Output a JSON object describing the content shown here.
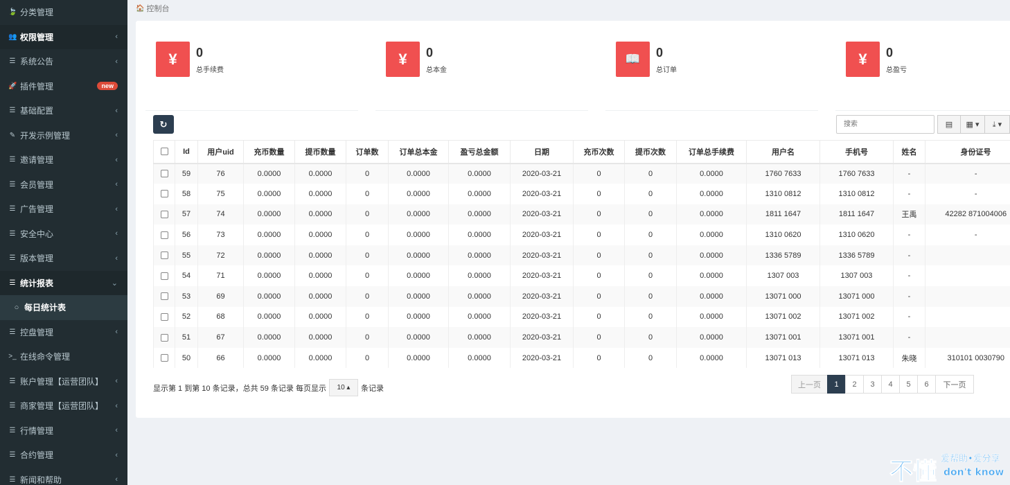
{
  "sidebar": {
    "items": [
      {
        "icon": "leaf-icon",
        "glyph": "🍃",
        "label": "分类管理",
        "chevron": "",
        "state": ""
      },
      {
        "icon": "users-icon",
        "glyph": "👥",
        "label": "权限管理",
        "chevron": "‹",
        "state": "active-bold"
      },
      {
        "icon": "list-icon",
        "glyph": "☰",
        "label": "系统公告",
        "chevron": "‹",
        "state": ""
      },
      {
        "icon": "rocket-icon",
        "glyph": "🚀",
        "label": "插件管理",
        "chevron": "",
        "state": "",
        "badge": "new"
      },
      {
        "icon": "list-icon",
        "glyph": "☰",
        "label": "基础配置",
        "chevron": "‹",
        "state": ""
      },
      {
        "icon": "magic-icon",
        "glyph": "✎",
        "label": "开发示例管理",
        "chevron": "‹",
        "state": ""
      },
      {
        "icon": "list-icon",
        "glyph": "☰",
        "label": "邀请管理",
        "chevron": "‹",
        "state": ""
      },
      {
        "icon": "list-icon",
        "glyph": "☰",
        "label": "会员管理",
        "chevron": "‹",
        "state": ""
      },
      {
        "icon": "list-icon",
        "glyph": "☰",
        "label": "广告管理",
        "chevron": "‹",
        "state": ""
      },
      {
        "icon": "list-icon",
        "glyph": "☰",
        "label": "安全中心",
        "chevron": "‹",
        "state": ""
      },
      {
        "icon": "list-icon",
        "glyph": "☰",
        "label": "版本管理",
        "chevron": "‹",
        "state": ""
      },
      {
        "icon": "list-icon",
        "glyph": "☰",
        "label": "统计报表",
        "chevron": "⌄",
        "state": "active-bold"
      },
      {
        "icon": "circle-icon",
        "glyph": "○",
        "label": "每日统计表",
        "chevron": "",
        "state": "sub"
      },
      {
        "icon": "list-icon",
        "glyph": "☰",
        "label": "控盘管理",
        "chevron": "‹",
        "state": ""
      },
      {
        "icon": "terminal-icon",
        "glyph": ">_",
        "label": "在线命令管理",
        "chevron": "",
        "state": ""
      },
      {
        "icon": "list-icon",
        "glyph": "☰",
        "label": "账户管理【运营团队】",
        "chevron": "‹",
        "state": ""
      },
      {
        "icon": "list-icon",
        "glyph": "☰",
        "label": "商家管理【运营团队】",
        "chevron": "‹",
        "state": ""
      },
      {
        "icon": "list-icon",
        "glyph": "☰",
        "label": "行情管理",
        "chevron": "‹",
        "state": ""
      },
      {
        "icon": "list-icon",
        "glyph": "☰",
        "label": "合约管理",
        "chevron": "‹",
        "state": ""
      },
      {
        "icon": "list-icon",
        "glyph": "☰",
        "label": "新闻和帮助",
        "chevron": "‹",
        "state": ""
      }
    ]
  },
  "breadcrumb": {
    "icon": "dashboard-icon",
    "glyph": "🏠",
    "label": "控制台"
  },
  "stats": [
    {
      "icon": "yen-icon",
      "glyph": "¥",
      "value": "0",
      "label": "总手续费"
    },
    {
      "icon": "yen-icon",
      "glyph": "¥",
      "value": "0",
      "label": "总本金"
    },
    {
      "icon": "book-icon",
      "glyph": "📖",
      "value": "0",
      "label": "总订单"
    },
    {
      "icon": "yen-icon",
      "glyph": "¥",
      "value": "0",
      "label": "总盈亏"
    }
  ],
  "toolbar": {
    "refresh_glyph": "↻",
    "search_placeholder": "搜索",
    "view_glyph": "▤",
    "columns_glyph": "▦ ▾",
    "export_glyph": "⤓ ▾"
  },
  "table": {
    "headers": [
      "Id",
      "用户uid",
      "充币数量",
      "提币数量",
      "订单数",
      "订单总本金",
      "盈亏总金额",
      "日期",
      "充币次数",
      "提币次数",
      "订单总手续费",
      "用户名",
      "手机号",
      "姓名",
      "身份证号"
    ],
    "rows": [
      [
        "59",
        "76",
        "0.0000",
        "0.0000",
        "0",
        "0.0000",
        "0.0000",
        "2020-03-21",
        "0",
        "0",
        "0.0000",
        "1760     7633",
        "1760     7633",
        "-",
        "-"
      ],
      [
        "58",
        "75",
        "0.0000",
        "0.0000",
        "0",
        "0.0000",
        "0.0000",
        "2020-03-21",
        "0",
        "0",
        "0.0000",
        "1310     0812",
        "1310     0812",
        "-",
        "-"
      ],
      [
        "57",
        "74",
        "0.0000",
        "0.0000",
        "0",
        "0.0000",
        "0.0000",
        "2020-03-21",
        "0",
        "0",
        "0.0000",
        "1811     1647",
        "1811     1647",
        "王禹",
        "42282     871004006"
      ],
      [
        "56",
        "73",
        "0.0000",
        "0.0000",
        "0",
        "0.0000",
        "0.0000",
        "2020-03-21",
        "0",
        "0",
        "0.0000",
        "1310     0620",
        "1310     0620",
        "-",
        "-"
      ],
      [
        "55",
        "72",
        "0.0000",
        "0.0000",
        "0",
        "0.0000",
        "0.0000",
        "2020-03-21",
        "0",
        "0",
        "0.0000",
        "1336     5789",
        "1336     5789",
        "-",
        ""
      ],
      [
        "54",
        "71",
        "0.0000",
        "0.0000",
        "0",
        "0.0000",
        "0.0000",
        "2020-03-21",
        "0",
        "0",
        "0.0000",
        "1307     003",
        "1307     003",
        "-",
        ""
      ],
      [
        "53",
        "69",
        "0.0000",
        "0.0000",
        "0",
        "0.0000",
        "0.0000",
        "2020-03-21",
        "0",
        "0",
        "0.0000",
        "13071     000",
        "13071     000",
        "-",
        ""
      ],
      [
        "52",
        "68",
        "0.0000",
        "0.0000",
        "0",
        "0.0000",
        "0.0000",
        "2020-03-21",
        "0",
        "0",
        "0.0000",
        "13071     002",
        "13071     002",
        "-",
        ""
      ],
      [
        "51",
        "67",
        "0.0000",
        "0.0000",
        "0",
        "0.0000",
        "0.0000",
        "2020-03-21",
        "0",
        "0",
        "0.0000",
        "13071     001",
        "13071     001",
        "-",
        ""
      ],
      [
        "50",
        "66",
        "0.0000",
        "0.0000",
        "0",
        "0.0000",
        "0.0000",
        "2020-03-21",
        "0",
        "0",
        "0.0000",
        "13071     013",
        "13071     013",
        "朱晓",
        "310101     0030790"
      ]
    ]
  },
  "pagination": {
    "info_prefix": "显示第 1 到第 10 条记录，总共 59 条记录 每页显示",
    "page_size": "10 ▴",
    "info_suffix": "条记录",
    "prev": "上一页",
    "pages": [
      "1",
      "2",
      "3",
      "4",
      "5",
      "6"
    ],
    "active_page": "1",
    "next": "下一页"
  },
  "watermark": {
    "big": "不懂",
    "line1": "爱帮助•爱分享",
    "line2": "don't know"
  },
  "colors": {
    "sidebar_bg": "#222d32",
    "stat_icon": "#f05050",
    "primary_dark": "#2c3e50",
    "badge": "#dd4b39"
  }
}
